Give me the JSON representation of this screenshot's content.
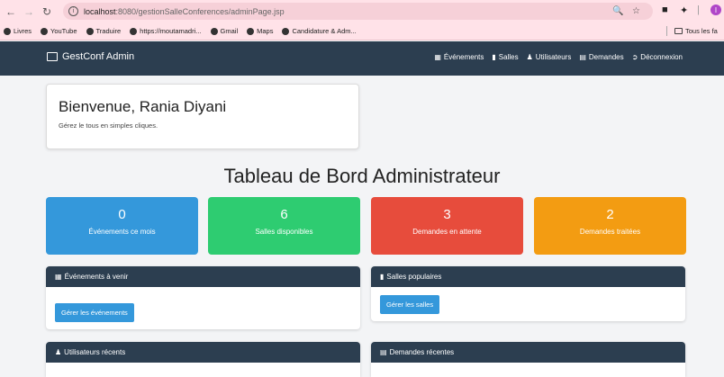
{
  "browser": {
    "url_host": "localhost",
    "url_path": ":8080/gestionSalleConferences/adminPage.jsp",
    "bookmarks": [
      "Livres",
      "YouTube",
      "Traduire",
      "https://moutamadri...",
      "Gmail",
      "Maps",
      "Candidature & Adm..."
    ],
    "all_bookmarks": "Tous les fa",
    "profile_initial": "I"
  },
  "navbar": {
    "brand": "GestConf Admin",
    "links": [
      {
        "icon": "calendar-icon",
        "label": "Événements"
      },
      {
        "icon": "door-icon",
        "label": "Salles"
      },
      {
        "icon": "users-icon",
        "label": "Utilisateurs"
      },
      {
        "icon": "inbox-icon",
        "label": "Demandes"
      },
      {
        "icon": "logout-icon",
        "label": "Déconnexion"
      }
    ]
  },
  "welcome": {
    "title": "Bienvenue, Rania Diyani",
    "subtitle": "Gérez le tous en simples cliques."
  },
  "dashboard_title": "Tableau de Bord Administrateur",
  "stats": [
    {
      "value": "0",
      "label": "Événements ce mois",
      "color": "#3498db"
    },
    {
      "value": "6",
      "label": "Salles disponibles",
      "color": "#2ecc71"
    },
    {
      "value": "3",
      "label": "Demandes en attente",
      "color": "#e74c3c"
    },
    {
      "value": "2",
      "label": "Demandes traitées",
      "color": "#f39c12"
    }
  ],
  "panels": {
    "events": {
      "title": "Événements à venir",
      "button": "Gérer les événements"
    },
    "rooms": {
      "title": "Salles populaires",
      "button": "Gérer les salles"
    },
    "users": {
      "title": "Utilisateurs récents"
    },
    "requests": {
      "title": "Demandes récentes"
    }
  }
}
